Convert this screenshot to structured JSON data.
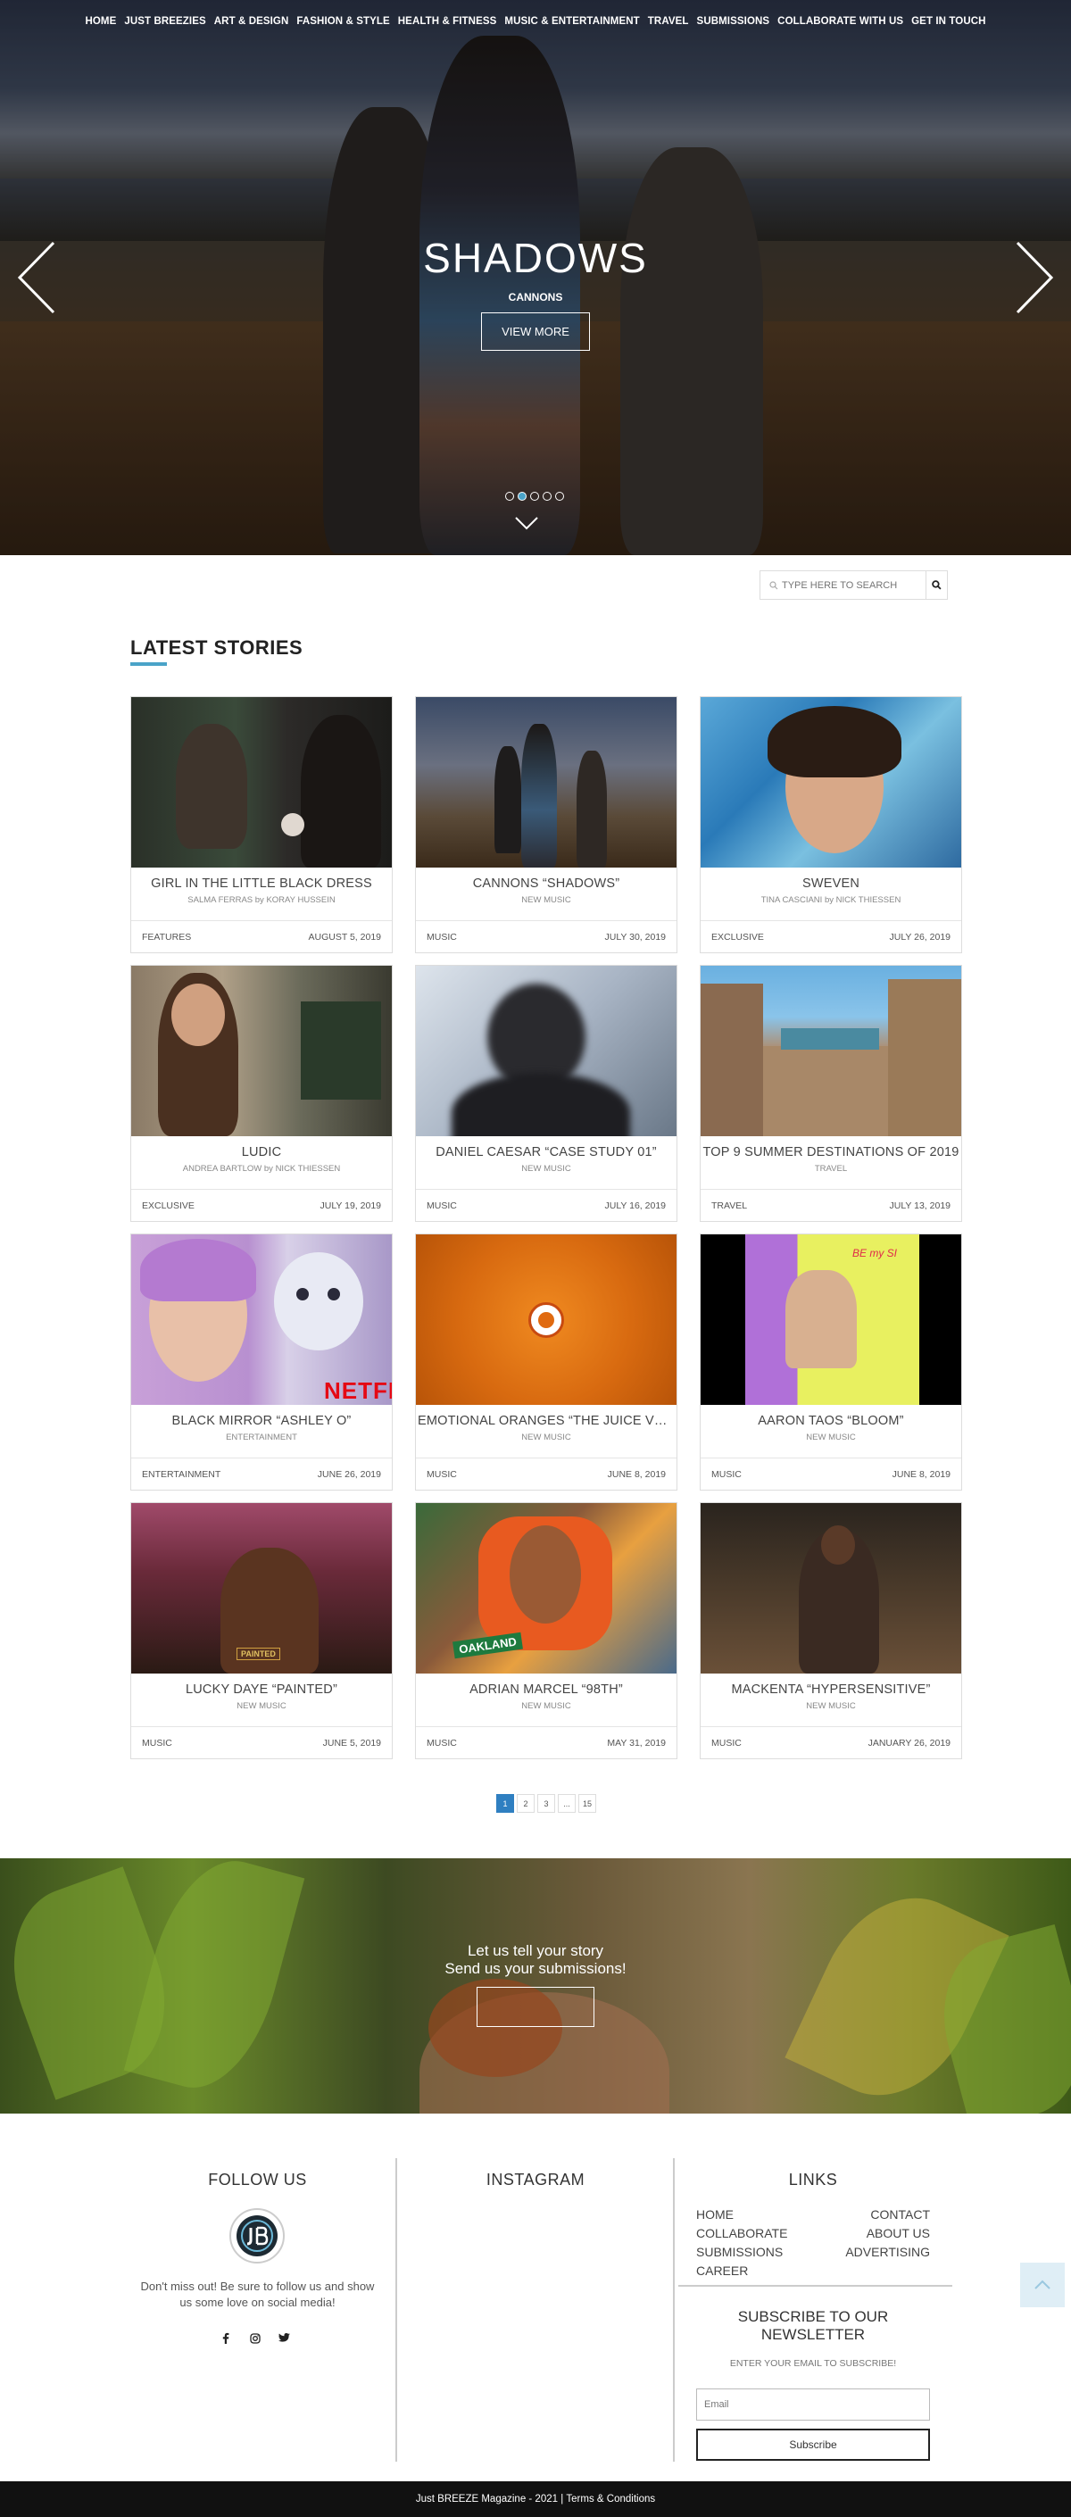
{
  "nav": [
    "HOME",
    "JUST BREEZIES",
    "ART & DESIGN",
    "FASHION & STYLE",
    "HEALTH & FITNESS",
    "MUSIC & ENTERTAINMENT",
    "TRAVEL",
    "SUBMISSIONS",
    "COLLABORATE WITH US",
    "GET IN TOUCH"
  ],
  "hero": {
    "title": "SHADOWS",
    "subtitle": "CANNONS",
    "button": "VIEW MORE",
    "slides_total": 5,
    "active_slide": 2
  },
  "search": {
    "placeholder": "TYPE HERE TO SEARCH"
  },
  "latest_heading": "LATEST STORIES",
  "accent_color": "#4aa3c8",
  "stories": [
    {
      "title": "GIRL IN THE LITTLE BLACK DRESS",
      "byline": "SALMA FERRAS by KORAY HUSSEIN",
      "category": "FEATURES",
      "date": "AUGUST 5, 2019"
    },
    {
      "title": "CANNONS “SHADOWS”",
      "byline": "NEW MUSIC",
      "category": "MUSIC",
      "date": "JULY 30, 2019"
    },
    {
      "title": "SWEVEN",
      "byline": "TINA CASCIANI by NICK THIESSEN",
      "category": "EXCLUSIVE",
      "date": "JULY 26, 2019"
    },
    {
      "title": "LUDIC",
      "byline": "ANDREA BARTLOW by NICK THIESSEN",
      "category": "EXCLUSIVE",
      "date": "JULY 19, 2019"
    },
    {
      "title": "DANIEL CAESAR “CASE STUDY 01”",
      "byline": "NEW MUSIC",
      "category": "MUSIC",
      "date": "JULY 16, 2019"
    },
    {
      "title": "TOP 9 SUMMER DESTINATIONS OF 2019",
      "byline": "TRAVEL",
      "category": "TRAVEL",
      "date": "JULY 13, 2019"
    },
    {
      "title": "BLACK MIRROR “ASHLEY O”",
      "byline": "ENTERTAINMENT",
      "category": "ENTERTAINMENT",
      "date": "JUNE 26, 2019"
    },
    {
      "title": "EMOTIONAL ORANGES “THE JUICE VOLU...",
      "byline": "NEW MUSIC",
      "category": "MUSIC",
      "date": "JUNE 8, 2019"
    },
    {
      "title": "AARON TAOS “BLOOM”",
      "byline": "NEW MUSIC",
      "category": "MUSIC",
      "date": "JUNE 8, 2019"
    },
    {
      "title": "LUCKY DAYE “PAINTED”",
      "byline": "NEW MUSIC",
      "category": "MUSIC",
      "date": "JUNE 5, 2019"
    },
    {
      "title": "ADRIAN MARCEL “98TH”",
      "byline": "NEW MUSIC",
      "category": "MUSIC",
      "date": "MAY 31, 2019"
    },
    {
      "title": "MACKENTA “HYPERSENSITIVE”",
      "byline": "NEW MUSIC",
      "category": "MUSIC",
      "date": "JANUARY 26, 2019"
    }
  ],
  "image_labels": {
    "netflix": "NETFLIX",
    "painted": "PAINTED",
    "oakland": "OAKLAND",
    "bloom_tag": "BE my SI"
  },
  "pagination": [
    "1",
    "2",
    "3",
    "...",
    "15"
  ],
  "cta": {
    "line1": "Let us tell your story",
    "line2": "Send us your submissions!"
  },
  "footer": {
    "follow_title": "FOLLOW US",
    "follow_text": "Don't miss out! Be sure to follow us and show us some love on social media!",
    "instagram_title": "INSTAGRAM",
    "links_title": "LINKS",
    "links_left": [
      "HOME",
      "COLLABORATE",
      "SUBMISSIONS",
      "CAREER"
    ],
    "links_right": [
      "CONTACT",
      "ABOUT US",
      "ADVERTISING"
    ],
    "subscribe_title": "SUBSCRIBE TO OUR NEWSLETTER",
    "subscribe_hint": "ENTER YOUR EMAIL TO SUBSCRIBE!",
    "email_placeholder": "Email",
    "subscribe_button": "Subscribe",
    "social_icons": [
      "facebook-icon",
      "instagram-icon",
      "twitter-icon"
    ]
  },
  "bottom_bar": {
    "copyright": "Just BREEZE Magazine - 2021 | ",
    "terms": "Terms & Conditions"
  }
}
